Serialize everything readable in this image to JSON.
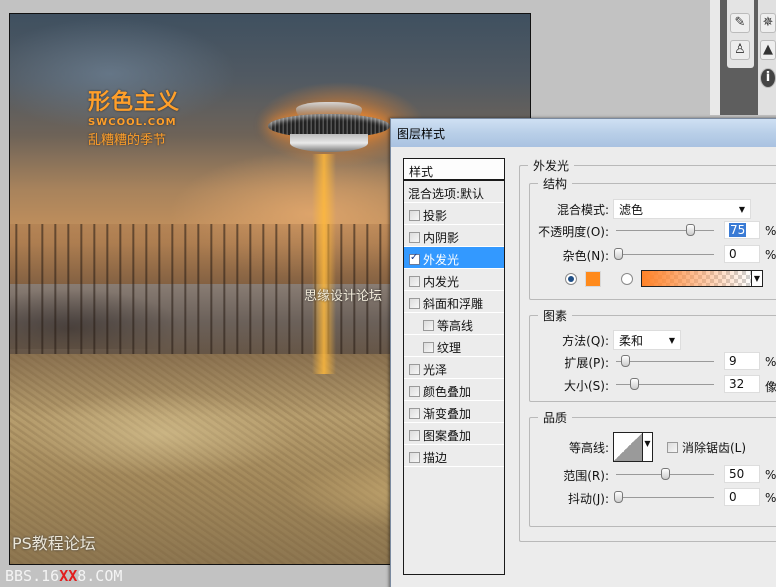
{
  "canvas": {
    "logo_line1": "形色主义",
    "logo_line2": "SWCOOL.COM",
    "logo_line3": "乱糟糟的季节",
    "watermark_mid": "思缘设计论坛",
    "watermark_ps": "PS教程论坛",
    "watermark_bbs_prefix": "BBS.16",
    "watermark_bbs_red": "XX",
    "watermark_bbs_suffix": "8.COM"
  },
  "palette_icons": [
    "brush-presets-icon",
    "clone-source-icon",
    "navigator-icon",
    "histogram-icon",
    "info-icon"
  ],
  "dialog": {
    "title": "图层样式",
    "styles_header": "样式",
    "blending_options": "混合选项:默认",
    "style_items": [
      {
        "label": "投影",
        "checked": false,
        "indent": false,
        "selected": false
      },
      {
        "label": "内阴影",
        "checked": false,
        "indent": false,
        "selected": false
      },
      {
        "label": "外发光",
        "checked": true,
        "indent": false,
        "selected": true
      },
      {
        "label": "内发光",
        "checked": false,
        "indent": false,
        "selected": false
      },
      {
        "label": "斜面和浮雕",
        "checked": false,
        "indent": false,
        "selected": false
      },
      {
        "label": "等高线",
        "checked": false,
        "indent": true,
        "selected": false
      },
      {
        "label": "纹理",
        "checked": false,
        "indent": true,
        "selected": false
      },
      {
        "label": "光泽",
        "checked": false,
        "indent": false,
        "selected": false
      },
      {
        "label": "颜色叠加",
        "checked": false,
        "indent": false,
        "selected": false
      },
      {
        "label": "渐变叠加",
        "checked": false,
        "indent": false,
        "selected": false
      },
      {
        "label": "图案叠加",
        "checked": false,
        "indent": false,
        "selected": false
      },
      {
        "label": "描边",
        "checked": false,
        "indent": false,
        "selected": false
      }
    ],
    "panel_title": "外发光",
    "structure": {
      "title": "结构",
      "blend_mode_label": "混合模式:",
      "blend_mode_value": "滤色",
      "opacity_label": "不透明度(O):",
      "opacity_value": "75",
      "opacity_unit": "%",
      "noise_label": "杂色(N):",
      "noise_value": "0",
      "noise_unit": "%",
      "glow_color": "#ff8a1c",
      "color_radio_selected": "solid"
    },
    "elements": {
      "title": "图素",
      "technique_label": "方法(Q):",
      "technique_value": "柔和",
      "spread_label": "扩展(P):",
      "spread_value": "9",
      "spread_unit": "%",
      "size_label": "大小(S):",
      "size_value": "32",
      "size_unit": "像"
    },
    "quality": {
      "title": "品质",
      "contour_label": "等高线:",
      "anti_alias_label": "消除锯齿(L)",
      "anti_alias_checked": false,
      "range_label": "范围(R):",
      "range_value": "50",
      "range_unit": "%",
      "jitter_label": "抖动(J):",
      "jitter_value": "0",
      "jitter_unit": "%"
    }
  }
}
